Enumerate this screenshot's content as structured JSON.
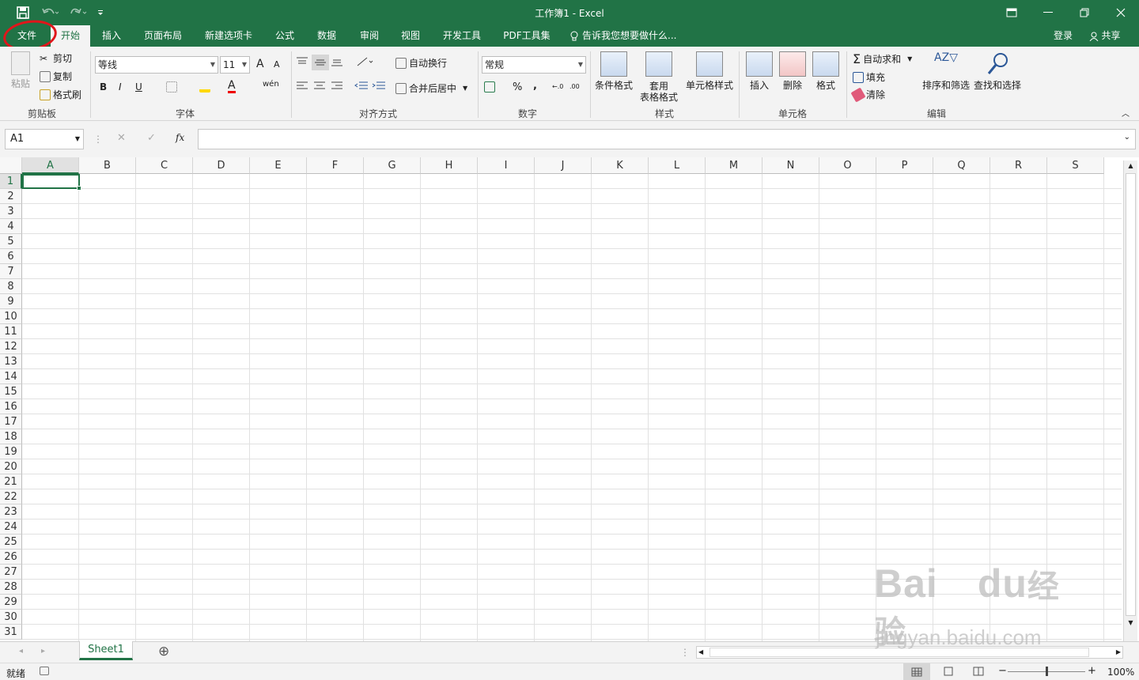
{
  "window": {
    "title": "工作簿1 - Excel"
  },
  "quick_access": {
    "save_icon": "save-icon",
    "undo_icon": "undo-icon",
    "redo_icon": "redo-icon",
    "customize_icon": "customize-qat-icon"
  },
  "tabs": {
    "file": "文件",
    "home": "开始",
    "insert": "插入",
    "page_layout": "页面布局",
    "new_tab": "新建选项卡",
    "formulas": "公式",
    "data": "数据",
    "review": "审阅",
    "view": "视图",
    "developer": "开发工具",
    "pdf": "PDF工具集",
    "tell_me": "告诉我您想要做什么...",
    "login": "登录",
    "share": "共享"
  },
  "ribbon": {
    "clipboard": {
      "paste": "粘贴",
      "cut": "剪切",
      "copy": "复制",
      "format_painter": "格式刷",
      "title": "剪贴板"
    },
    "font": {
      "font_name": "等线",
      "font_size": "11",
      "grow": "A",
      "shrink": "A",
      "bold": "B",
      "italic": "I",
      "underline": "U",
      "phonetic": "wén",
      "title": "字体"
    },
    "alignment": {
      "wrap": "自动换行",
      "merge": "合并后居中",
      "title": "对齐方式"
    },
    "number": {
      "format": "常规",
      "percent": "%",
      "comma": ",",
      "title": "数字"
    },
    "styles": {
      "conditional": "条件格式",
      "table1": "套用",
      "table2": "表格格式",
      "cell_styles": "单元格样式",
      "title": "样式"
    },
    "cells": {
      "insert": "插入",
      "delete": "删除",
      "format": "格式",
      "title": "单元格"
    },
    "editing": {
      "autosum": "自动求和",
      "fill": "填充",
      "clear": "清除",
      "sort": "排序和筛选",
      "find": "查找和选择",
      "title": "编辑"
    }
  },
  "formula_bar": {
    "name_box": "A1",
    "fx": "fx",
    "cancel": "✕",
    "enter": "✓",
    "value": ""
  },
  "sheet": {
    "columns": [
      "A",
      "B",
      "C",
      "D",
      "E",
      "F",
      "G",
      "H",
      "I",
      "J",
      "K",
      "L",
      "M",
      "N",
      "O",
      "P",
      "Q",
      "R",
      "S"
    ],
    "rows": [
      "1",
      "2",
      "3",
      "4",
      "5",
      "6",
      "7",
      "8",
      "9",
      "10",
      "11",
      "12",
      "13",
      "14",
      "15",
      "16",
      "17",
      "18",
      "19",
      "20",
      "21",
      "22",
      "23",
      "24",
      "25",
      "26",
      "27",
      "28",
      "29",
      "30",
      "31"
    ],
    "selected_cell": "A1"
  },
  "sheet_tabs": {
    "sheet1": "Sheet1",
    "add": "⊕"
  },
  "status": {
    "ready": "就绪",
    "zoom": "100%"
  },
  "watermark": {
    "brand": "Bai",
    "brand2": "du",
    "cn": "经验",
    "url": "jingyan.baidu.com"
  },
  "colors": {
    "excel_green": "#217346",
    "annotation_red": "#e0161b"
  }
}
